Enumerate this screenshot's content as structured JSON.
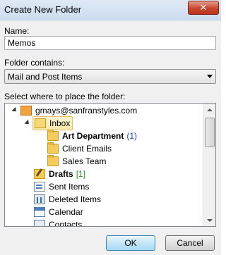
{
  "title": "Create New Folder",
  "name_label": "Name:",
  "name_value": "Memos",
  "contains_label": "Folder contains:",
  "contains_value": "Mail and Post Items",
  "place_label": "Select where to place the folder:",
  "tree": {
    "root": "gmays@sanfranstyles.com",
    "inbox": "Inbox",
    "art_department": "Art Department",
    "art_count": "(1)",
    "client_emails": "Client Emails",
    "sales_team": "Sales Team",
    "drafts": "Drafts",
    "drafts_count": "[1]",
    "sent_items": "Sent Items",
    "deleted_items": "Deleted Items",
    "calendar": "Calendar",
    "contacts": "Contacts"
  },
  "buttons": {
    "ok": "OK",
    "cancel": "Cancel"
  },
  "close_glyph": "✕"
}
